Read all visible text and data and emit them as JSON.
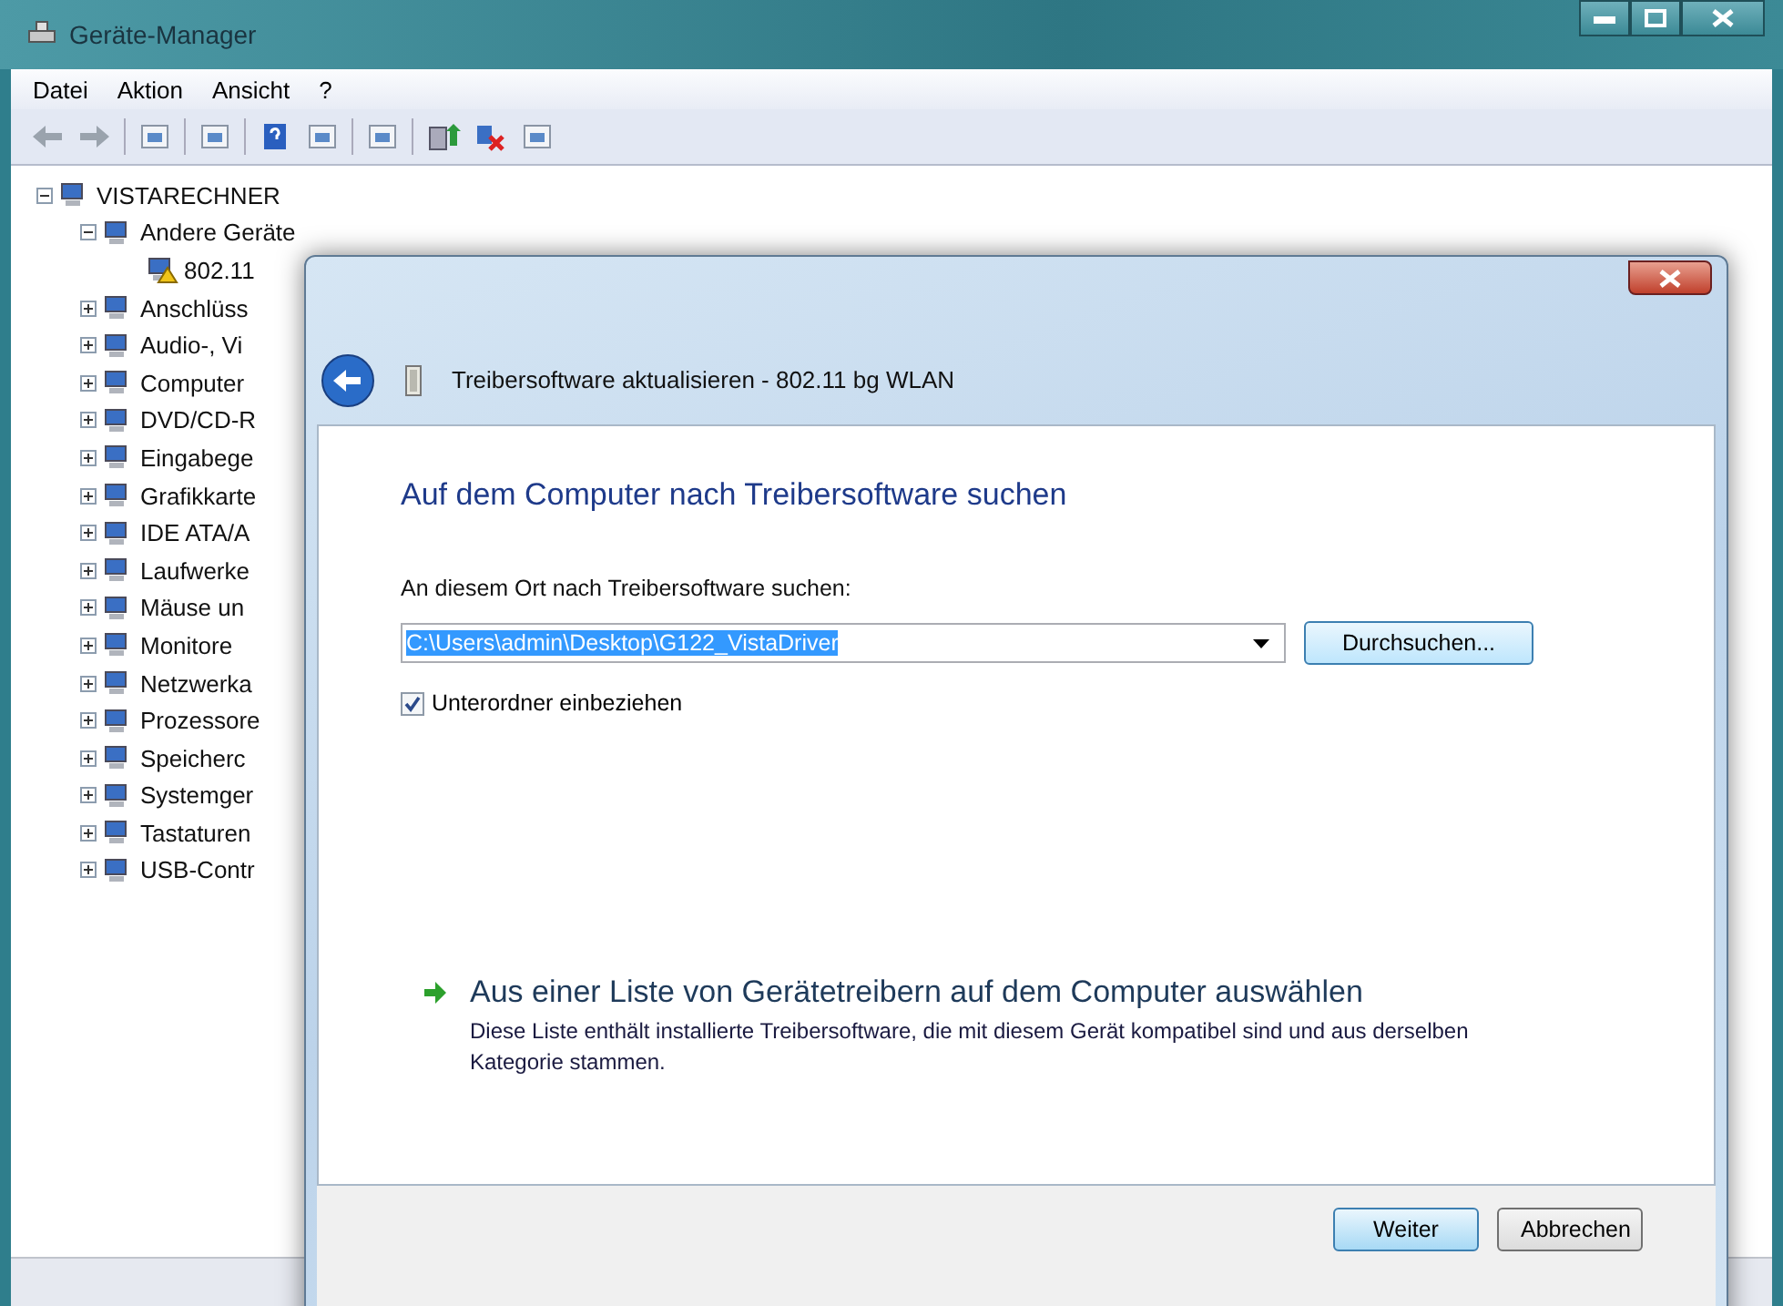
{
  "window": {
    "title": "Geräte-Manager"
  },
  "menu": [
    "Datei",
    "Aktion",
    "Ansicht",
    "?"
  ],
  "tree": {
    "label": "VISTARECHNER",
    "expanded": true,
    "children": [
      {
        "label": "Andere Geräte",
        "expanded": true,
        "children": [
          {
            "label": "802.11",
            "warning": true
          }
        ]
      },
      {
        "label": "Anschlüss",
        "expanded": false
      },
      {
        "label": "Audio-, Vi",
        "expanded": false
      },
      {
        "label": "Computer",
        "expanded": false
      },
      {
        "label": "DVD/CD-R",
        "expanded": false
      },
      {
        "label": "Eingabege",
        "expanded": false
      },
      {
        "label": "Grafikkarte",
        "expanded": false
      },
      {
        "label": "IDE ATA/A",
        "expanded": false
      },
      {
        "label": "Laufwerke",
        "expanded": false
      },
      {
        "label": "Mäuse un",
        "expanded": false
      },
      {
        "label": "Monitore",
        "expanded": false
      },
      {
        "label": "Netzwerka",
        "expanded": false
      },
      {
        "label": "Prozessore",
        "expanded": false
      },
      {
        "label": "Speicherc",
        "expanded": false
      },
      {
        "label": "Systemger",
        "expanded": false
      },
      {
        "label": "Tastaturen",
        "expanded": false
      },
      {
        "label": "USB-Contr",
        "expanded": false
      }
    ]
  },
  "dialog": {
    "title": "Treibersoftware aktualisieren - 802.11 bg WLAN",
    "heading": "Auf dem Computer nach Treibersoftware suchen",
    "path_label": "An diesem Ort nach Treibersoftware suchen:",
    "path": {
      "value": "C:\\Users\\admin\\Desktop\\G122_VistaDriver",
      "selected": true
    },
    "browse_button": "Durchsuchen...",
    "subfolders": {
      "label": "Unterordner einbeziehen",
      "checked": true
    },
    "option": {
      "title": "Aus einer Liste von Gerätetreibern auf dem Computer auswählen",
      "description": "Diese Liste enthält installierte Treibersoftware, die mit diesem Gerät kompatibel sind und aus derselben Kategorie stammen."
    },
    "buttons": [
      {
        "label": "Weiter",
        "default": true
      },
      {
        "label": "Abbrechen",
        "default": false
      }
    ]
  }
}
